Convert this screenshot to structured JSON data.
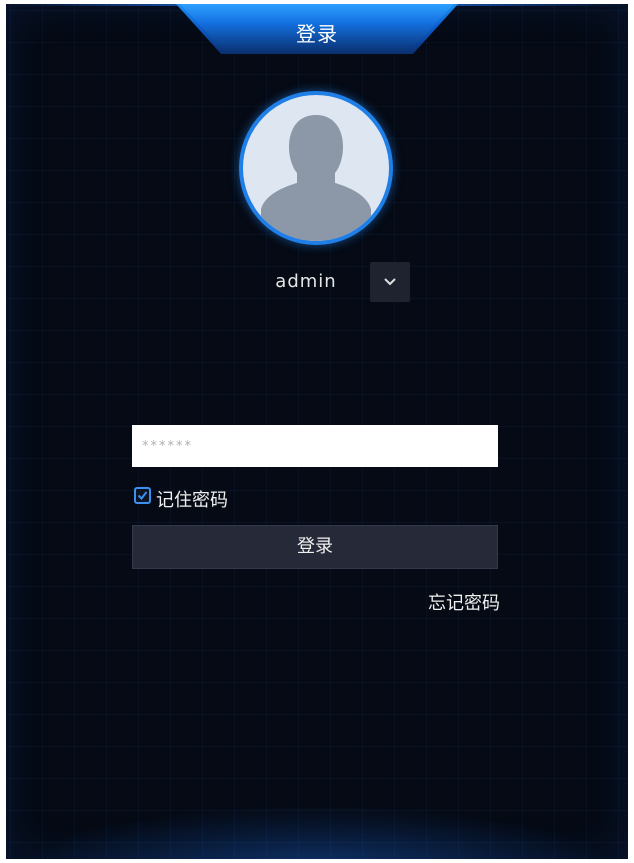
{
  "header": {
    "title": "登录"
  },
  "user": {
    "avatar_icon": "user-avatar-icon",
    "username": "admin",
    "dropdown_icon": "chevron-down-icon"
  },
  "password": {
    "placeholder": "******"
  },
  "remember": {
    "label": "记住密码",
    "checked": true
  },
  "actions": {
    "login_label": "登录",
    "forgot_label": "忘记密码"
  },
  "colors": {
    "accent": "#1f7fe6",
    "background": "#050a14",
    "button": "#262938"
  }
}
